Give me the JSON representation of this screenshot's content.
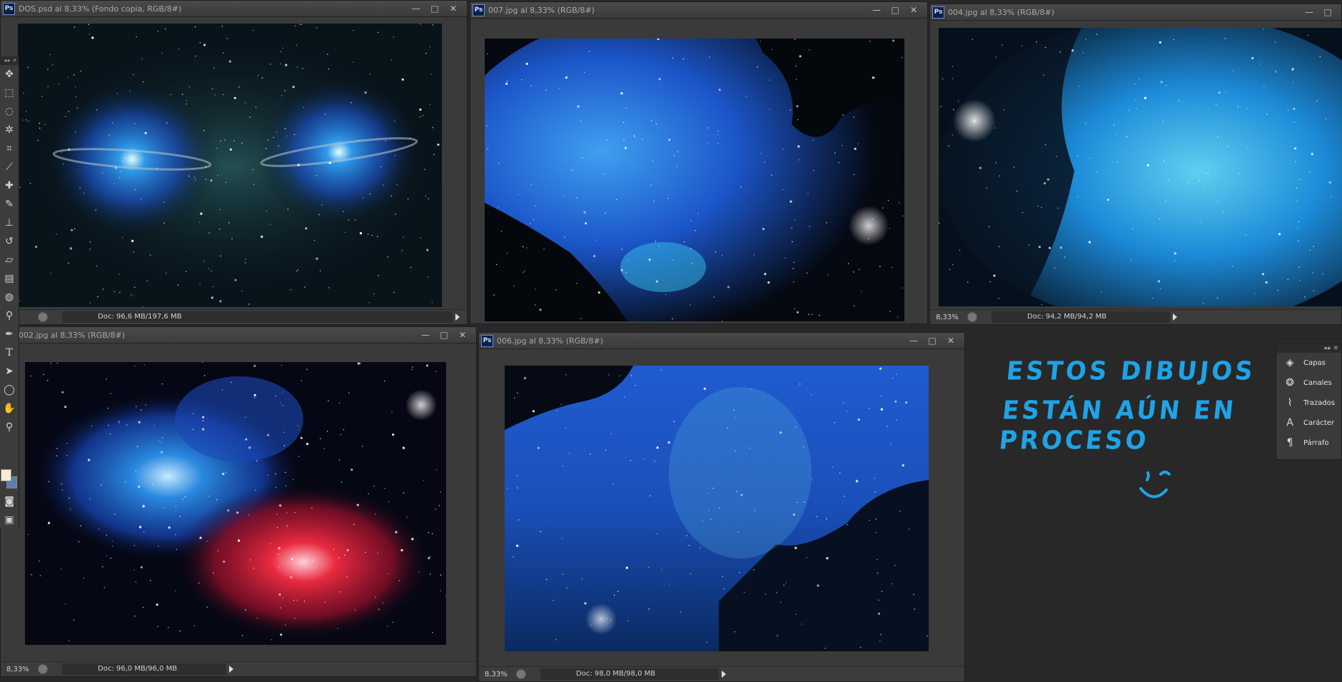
{
  "windows": {
    "dos": {
      "title": "DOS.psd al 8,33% (Fondo copia, RGB/8#)",
      "zoom": "%",
      "doc_info": "Doc: 96,6 MB/197,6 MB"
    },
    "w007": {
      "title": "007.jpg al 8,33% (RGB/8#)"
    },
    "w004": {
      "title": "004.jpg al 8,33% (RGB/8#)",
      "zoom": "8,33%",
      "doc_info": "Doc: 94,2 MB/94,2 MB"
    },
    "w002": {
      "title": "002.jpg al 8,33% (RGB/8#)",
      "zoom": "8,33%",
      "doc_info": "Doc: 96,0 MB/96,0 MB"
    },
    "w006": {
      "title": "006.jpg al 8,33% (RGB/8#)",
      "zoom": "8,33%",
      "doc_info": "Doc: 98,0 MB/98,0 MB"
    }
  },
  "window_controls": {
    "minimize": "—",
    "maximize": "□",
    "close": "✕"
  },
  "ps_badge": "Ps",
  "panels": {
    "items": [
      {
        "label": "Capas",
        "icon": "layers-icon"
      },
      {
        "label": "Canales",
        "icon": "channels-icon"
      },
      {
        "label": "Trazados",
        "icon": "paths-icon"
      },
      {
        "label": "Carácter",
        "icon": "character-icon"
      },
      {
        "label": "Párrafo",
        "icon": "paragraph-icon"
      }
    ]
  },
  "handwritten_note": {
    "line1": "ESTOS DIBUJOS",
    "line2": "ESTÁN AÚN EN PROCESO"
  },
  "colors": {
    "app_bg": "#282828",
    "note_blue": "#1ea3e6",
    "foreground_swatch": "#f5edd2",
    "background_swatch": "#5a7fb6"
  }
}
